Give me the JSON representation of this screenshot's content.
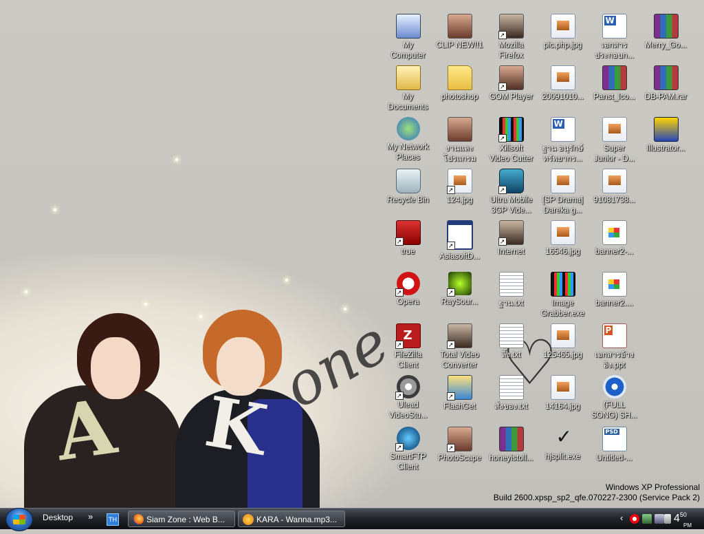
{
  "desktop": {
    "icons": [
      {
        "label": "My\nComputer",
        "icon": "my-computer-icon",
        "shortcut": false
      },
      {
        "label": "CLIP NEW!!1",
        "icon": "photo-folder-icon",
        "shortcut": false
      },
      {
        "label": "Mozilla\nFirefox",
        "icon": "firefox-photo-icon",
        "shortcut": true
      },
      {
        "label": "pic.php.jpg",
        "icon": "jpg-file-icon",
        "shortcut": false
      },
      {
        "label": "เอกสาร\nประกอบก...",
        "icon": "word-doc-icon",
        "shortcut": false
      },
      {
        "label": "Merry_Go...",
        "icon": "rar-archive-icon",
        "shortcut": false
      },
      {
        "label": "My\nDocuments",
        "icon": "my-documents-icon",
        "shortcut": false
      },
      {
        "label": "photoshop",
        "icon": "folder-icon",
        "shortcut": false
      },
      {
        "label": "GOM Player",
        "icon": "gom-player-icon",
        "shortcut": true
      },
      {
        "label": "20091010...",
        "icon": "jpg-file-icon",
        "shortcut": false
      },
      {
        "label": "Panst_Ico...",
        "icon": "rar-archive-icon",
        "shortcut": false
      },
      {
        "label": "DB-PAM.rar",
        "icon": "rar-archive-icon",
        "shortcut": false
      },
      {
        "label": "My Network\nPlaces",
        "icon": "network-places-icon",
        "shortcut": false
      },
      {
        "label": "งานและ\nโปรแกรม",
        "icon": "photo-folder-icon",
        "shortcut": false
      },
      {
        "label": "Xilisoft\nVideo Cutter",
        "icon": "film-clapper-icon",
        "shortcut": true
      },
      {
        "label": "ฐาน อนุรักษ์\nทรัพยากร...",
        "icon": "word-doc-icon",
        "shortcut": false
      },
      {
        "label": "Super\nJunior - D...",
        "icon": "jpg-file-icon",
        "shortcut": false
      },
      {
        "label": "Illustrator...",
        "icon": "illustrator-icon",
        "shortcut": false
      },
      {
        "label": "Recycle Bin",
        "icon": "recycle-bin-icon",
        "shortcut": false
      },
      {
        "label": "124.jpg",
        "icon": "jpg-file-icon",
        "shortcut": true
      },
      {
        "label": "Ultra Mobile\n3GP Vide...",
        "icon": "mobile-video-icon",
        "shortcut": true
      },
      {
        "label": "[SP Drama]\nDareka g...",
        "icon": "jpg-file-icon",
        "shortcut": false
      },
      {
        "label": "91081738...",
        "icon": "jpg-file-icon",
        "shortcut": false
      },
      {
        "label": "",
        "icon": "",
        "shortcut": false
      },
      {
        "label": "true",
        "icon": "binary-network-icon",
        "shortcut": true
      },
      {
        "label": "AsiasoftD...",
        "icon": "application-window-icon",
        "shortcut": true
      },
      {
        "label": "Internet",
        "icon": "internet-photo-icon",
        "shortcut": true
      },
      {
        "label": "16546.jpg",
        "icon": "jpg-file-icon",
        "shortcut": false
      },
      {
        "label": "banner2-...",
        "icon": "image-file-icon",
        "shortcut": false
      },
      {
        "label": "",
        "icon": "",
        "shortcut": false
      },
      {
        "label": "Opera",
        "icon": "opera-icon",
        "shortcut": true
      },
      {
        "label": "RaySour...",
        "icon": "raysource-icon",
        "shortcut": true
      },
      {
        "label": "ฐาน.txt",
        "icon": "text-file-icon",
        "shortcut": false
      },
      {
        "label": "Image\nGrabber.exe",
        "icon": "image-grabber-icon",
        "shortcut": false
      },
      {
        "label": "banner2....",
        "icon": "image-file-icon",
        "shortcut": false
      },
      {
        "label": "",
        "icon": "",
        "shortcut": false
      },
      {
        "label": "FileZilla\nClient",
        "icon": "filezilla-icon",
        "shortcut": true
      },
      {
        "label": "Total Video\nConverter",
        "icon": "photo-app-icon",
        "shortcut": true
      },
      {
        "label": "ลิ้ง.txt",
        "icon": "text-file-icon",
        "shortcut": false
      },
      {
        "label": "125465.jpg",
        "icon": "jpg-file-icon",
        "shortcut": false
      },
      {
        "label": "เอกสารอ้าง\nอิง.ppt",
        "icon": "powerpoint-icon",
        "shortcut": false
      },
      {
        "label": "",
        "icon": "",
        "shortcut": false
      },
      {
        "label": "Ulead\nVideoStu...",
        "icon": "ulead-disc-icon",
        "shortcut": true
      },
      {
        "label": "FlashGet",
        "icon": "flashget-icon",
        "shortcut": true
      },
      {
        "label": "สั่งของ.txt",
        "icon": "text-file-icon",
        "shortcut": false
      },
      {
        "label": "14164.jpg",
        "icon": "jpg-file-icon",
        "shortcut": false
      },
      {
        "label": "(FULL\nSONG) SH...",
        "icon": "media-file-icon",
        "shortcut": false
      },
      {
        "label": "",
        "icon": "",
        "shortcut": false
      },
      {
        "label": "SmartFTP\nClient",
        "icon": "smartftp-icon",
        "shortcut": true
      },
      {
        "label": "PhotoScape",
        "icon": "photoscape-icon",
        "shortcut": true
      },
      {
        "label": "honeyistoll...",
        "icon": "rar-archive-icon",
        "shortcut": false
      },
      {
        "label": "hjsplit.exe",
        "icon": "checkmark-icon",
        "shortcut": false
      },
      {
        "label": "Untitled-...",
        "icon": "psd-file-icon",
        "shortcut": false
      }
    ]
  },
  "build_info": {
    "line1": "Windows XP Professional",
    "line2": "Build 2600.xpsp_sp2_qfe.070227-2300 (Service Pack 2)"
  },
  "taskbar": {
    "toolbar_label": "Desktop",
    "chevron": "»",
    "language": "TH",
    "tasks": [
      {
        "label": "Siam Zone : Web B...",
        "icon": "firefox-icon"
      },
      {
        "label": "KARA - Wanna.mp3...",
        "icon": "media-player-icon"
      }
    ],
    "tray_chevron": "‹",
    "clock_hour": "4",
    "clock_min": "50",
    "clock_ampm": "PM"
  }
}
